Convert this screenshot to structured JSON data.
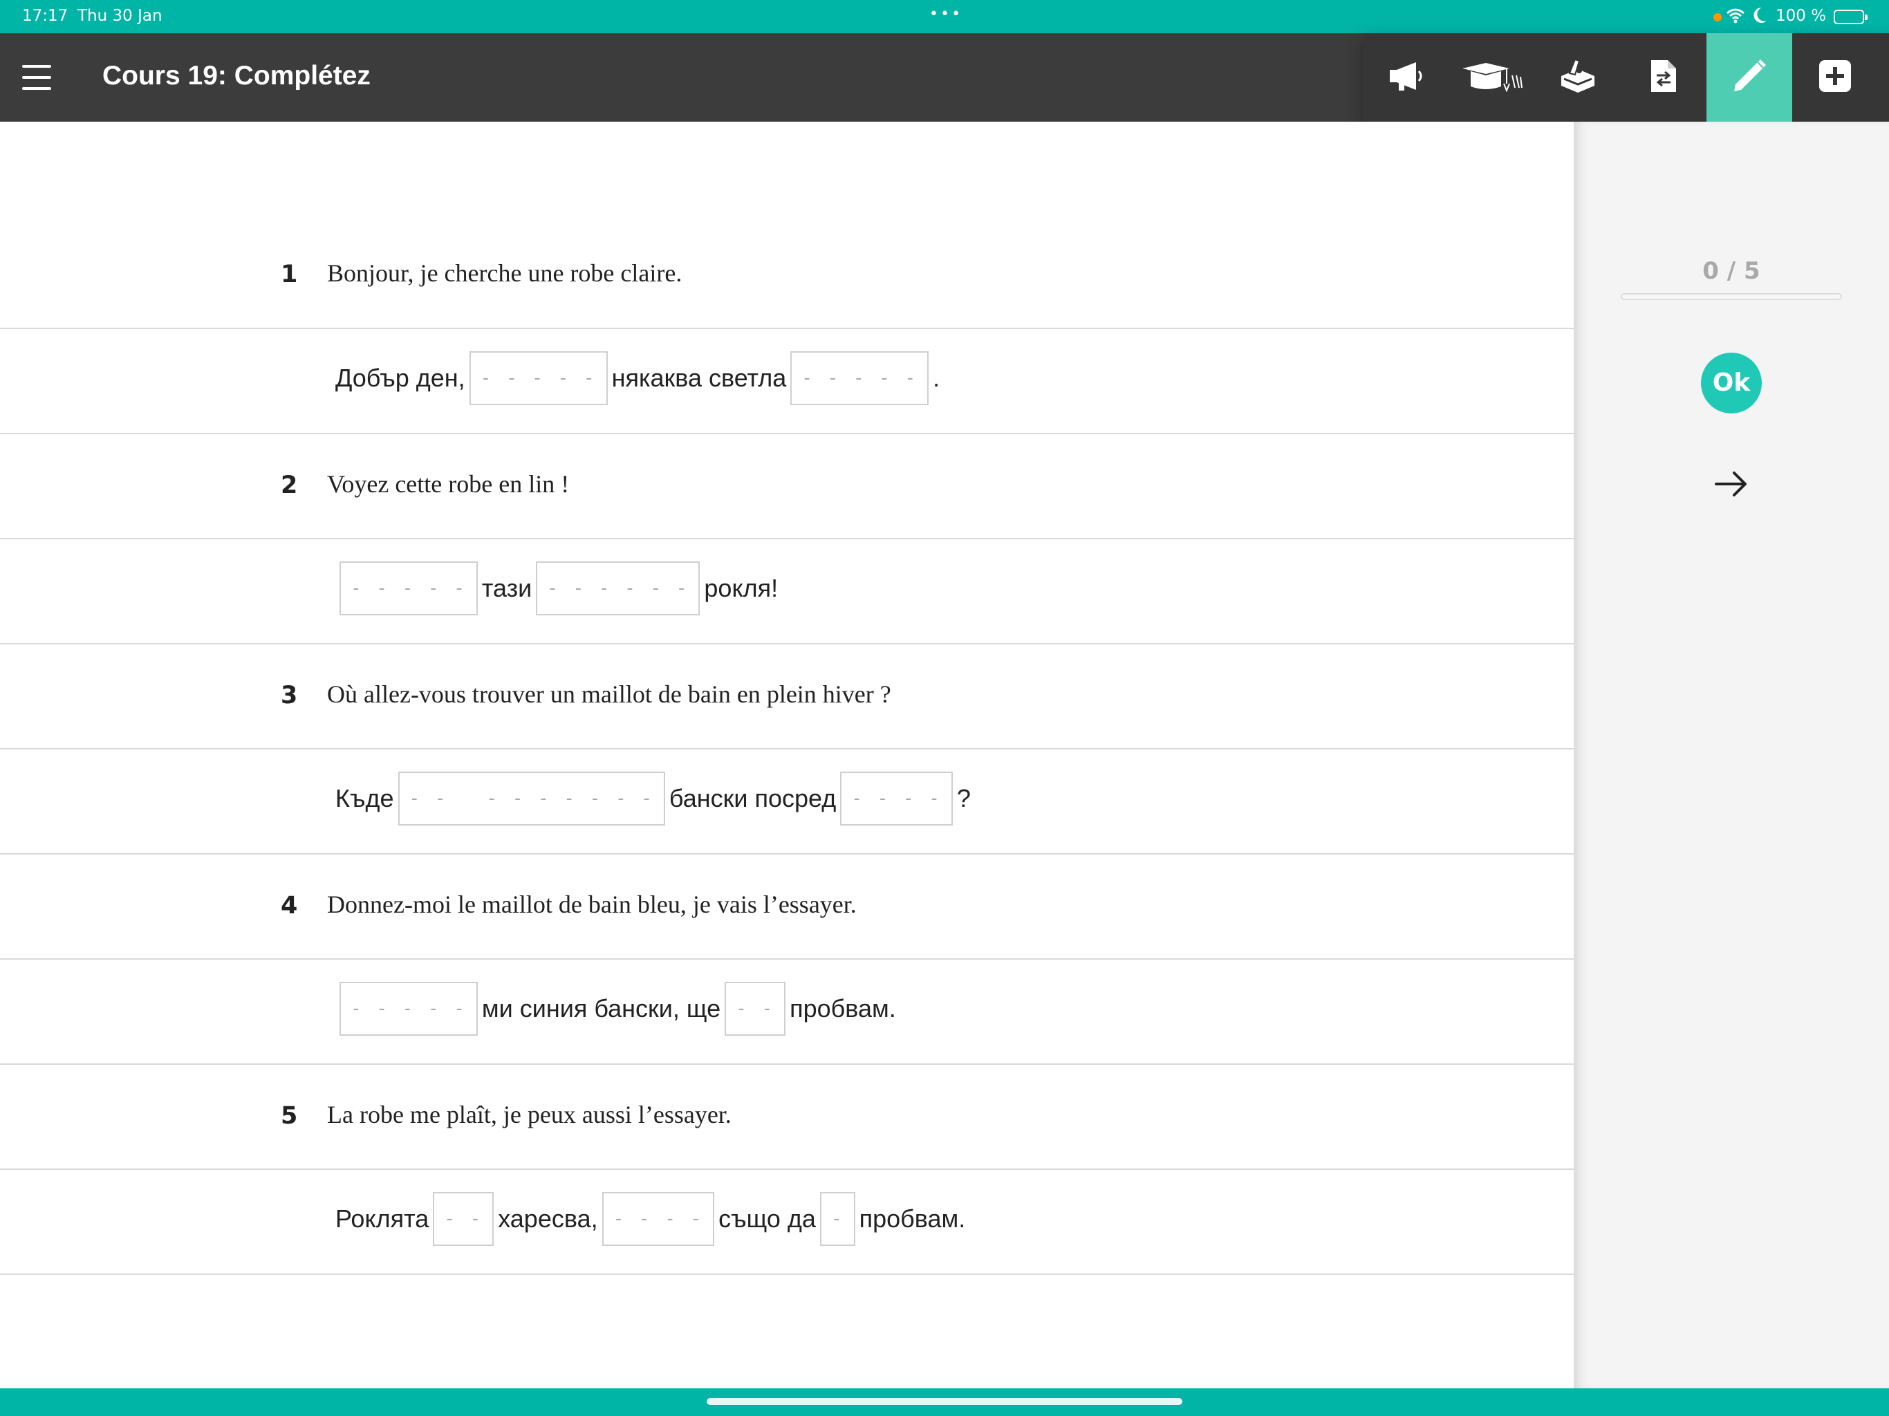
{
  "status_bar": {
    "time": "17:17",
    "date": "Thu 30 Jan",
    "battery": "100 %"
  },
  "header": {
    "title": "Cours 19: Complétez"
  },
  "toolbar": {
    "buttons": [
      {
        "icon": "megaphone-icon"
      },
      {
        "icon": "graduation-cap-icon"
      },
      {
        "icon": "workbook-icon"
      },
      {
        "icon": "document-swap-icon"
      },
      {
        "icon": "pencil-icon",
        "active": true
      },
      {
        "icon": "plus-square-icon"
      }
    ],
    "accent_color": "#4ecdb2"
  },
  "exercise": {
    "items": [
      {
        "number": "1",
        "french": "Bonjour, je cherche une robe claire.",
        "bulgarian": [
          {
            "t": "Добър ден,"
          },
          {
            "b": "- - - - -"
          },
          {
            "t": "някаква светла"
          },
          {
            "b": "- - - - -"
          },
          {
            "t": "."
          }
        ]
      },
      {
        "number": "2",
        "french": "Voyez cette robe en lin !",
        "bulgarian": [
          {
            "b": "- - - - -"
          },
          {
            "t": "тази"
          },
          {
            "b": "- - - - - -"
          },
          {
            "t": "рокля!"
          }
        ]
      },
      {
        "number": "3",
        "french": "Où allez-vous trouver un maillot de bain en plein hiver ?",
        "bulgarian": [
          {
            "t": "Къде"
          },
          {
            "b": "- -   - - - - - - -"
          },
          {
            "t": "бански посред"
          },
          {
            "b": "- - - -"
          },
          {
            "t": "?"
          }
        ]
      },
      {
        "number": "4",
        "french": "Donnez-moi le maillot de bain bleu, je vais l’essayer.",
        "bulgarian": [
          {
            "b": "- - - - -"
          },
          {
            "t": "ми синия бански, ще"
          },
          {
            "b": "- -"
          },
          {
            "t": "пробвам."
          }
        ]
      },
      {
        "number": "5",
        "french": "La robe me plaît, je peux aussi l’essayer.",
        "bulgarian": [
          {
            "t": "Роклята"
          },
          {
            "b": "- -"
          },
          {
            "t": "харесва,"
          },
          {
            "b": "- - - -"
          },
          {
            "t": "също да"
          },
          {
            "b": "-"
          },
          {
            "t": "пробвам."
          }
        ]
      }
    ]
  },
  "side_panel": {
    "score": "0 / 5",
    "progress": 0,
    "ok_label": "Ok",
    "next_icon": "arrow-right-icon"
  }
}
